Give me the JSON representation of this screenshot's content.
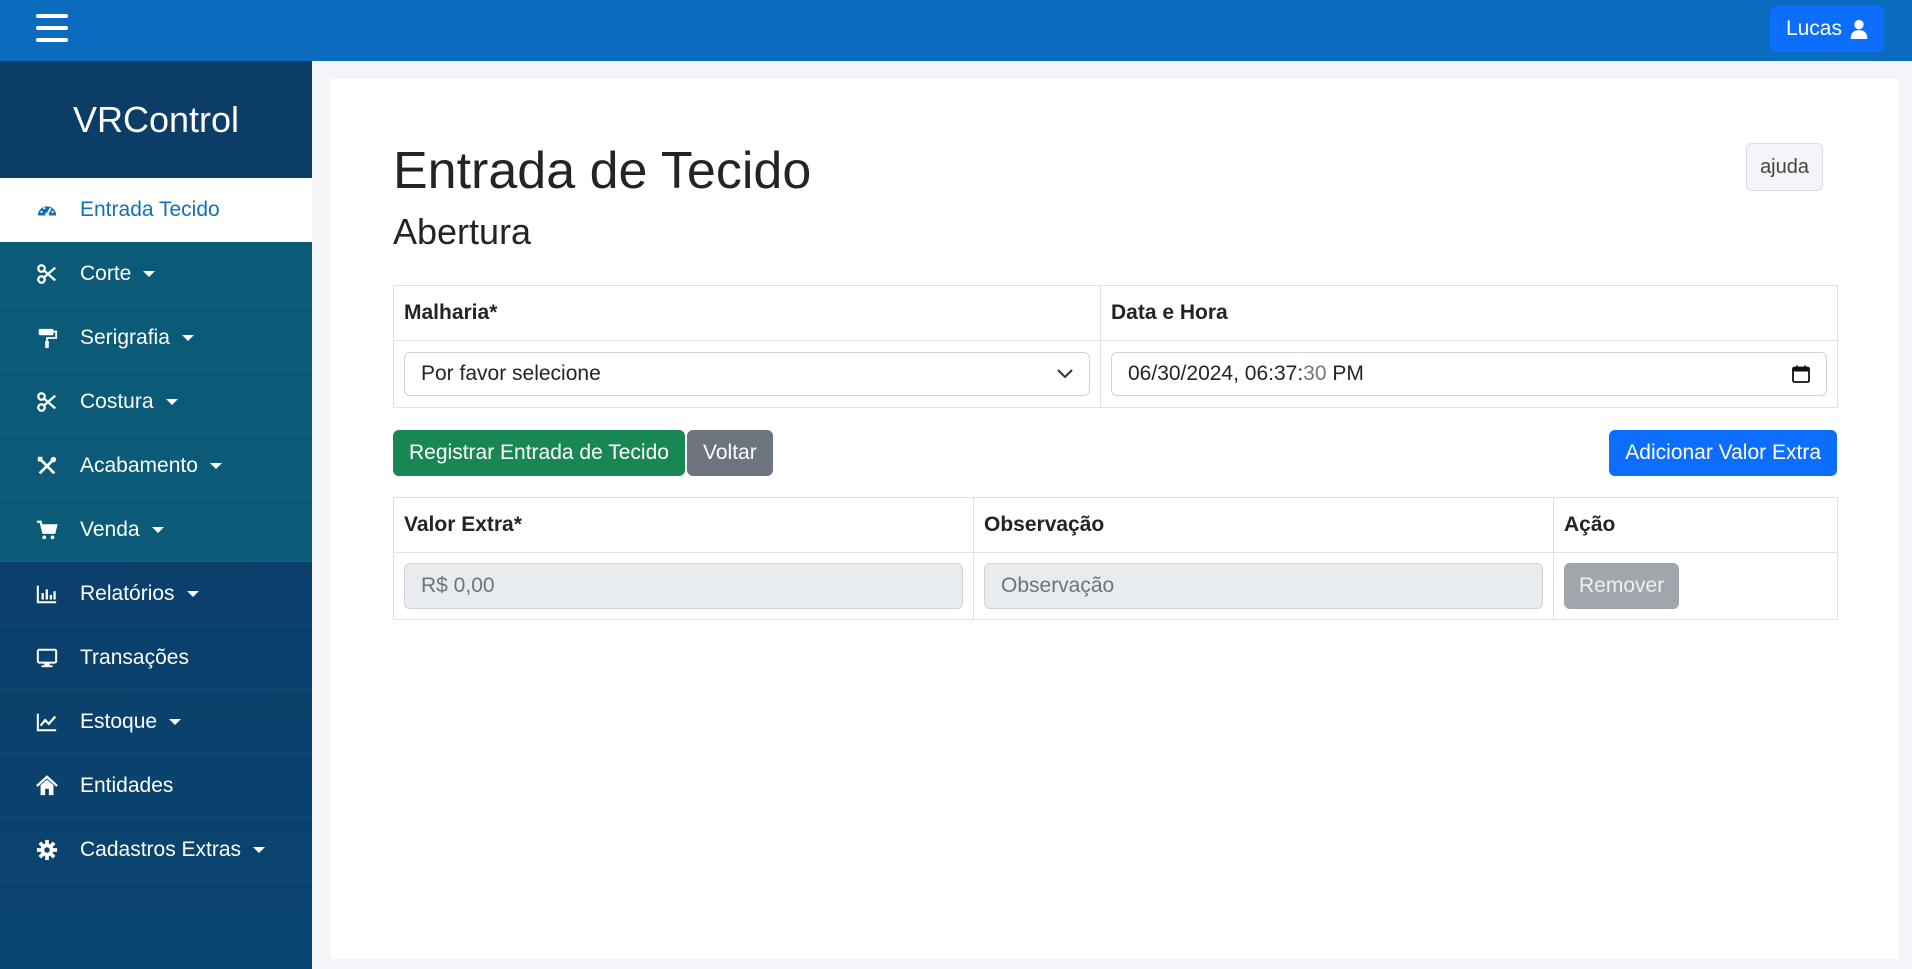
{
  "header": {
    "user_label": "Lucas"
  },
  "sidebar": {
    "brand": "VRControl",
    "items": [
      {
        "label": "Entrada Tecido",
        "icon": "gauge-icon",
        "caret": false,
        "active": true
      },
      {
        "label": "Corte",
        "icon": "scissors-icon",
        "caret": true
      },
      {
        "label": "Serigrafia",
        "icon": "paint-roller-icon",
        "caret": true
      },
      {
        "label": "Costura",
        "icon": "scissors-icon",
        "caret": true
      },
      {
        "label": "Acabamento",
        "icon": "tools-icon",
        "caret": true
      },
      {
        "label": "Venda",
        "icon": "cart-icon",
        "caret": true
      },
      {
        "label": "Relatórios",
        "icon": "bar-chart-icon",
        "caret": true
      },
      {
        "label": "Transações",
        "icon": "monitor-icon",
        "caret": false
      },
      {
        "label": "Estoque",
        "icon": "line-chart-icon",
        "caret": true
      },
      {
        "label": "Entidades",
        "icon": "home-icon",
        "caret": false
      },
      {
        "label": "Cadastros Extras",
        "icon": "gear-icon",
        "caret": true
      }
    ]
  },
  "main": {
    "title": "Entrada de Tecido",
    "subtitle": "Abertura",
    "help_label": "ajuda",
    "form_table": {
      "malharia_header": "Malharia*",
      "datetime_header": "Data e Hora",
      "malharia_value": "Por favor selecione",
      "datetime_value": "06/30/2024, 06:37:",
      "datetime_seconds": "30",
      "datetime_ampm": " PM"
    },
    "buttons": {
      "register": "Registrar Entrada de Tecido",
      "back": "Voltar",
      "add_extra": "Adicionar Valor Extra"
    },
    "extra_table": {
      "headers": [
        "Valor Extra*",
        "Observação",
        "Ação"
      ],
      "valor_placeholder": "R$ 0,00",
      "obs_placeholder": "Observação",
      "remove_label": "Remover"
    }
  },
  "colors": {
    "topbar": "#0a6bbf",
    "sidebar": "#0a3b64",
    "primary": "#0d6efd",
    "success": "#198754",
    "secondary": "#6c757d"
  }
}
